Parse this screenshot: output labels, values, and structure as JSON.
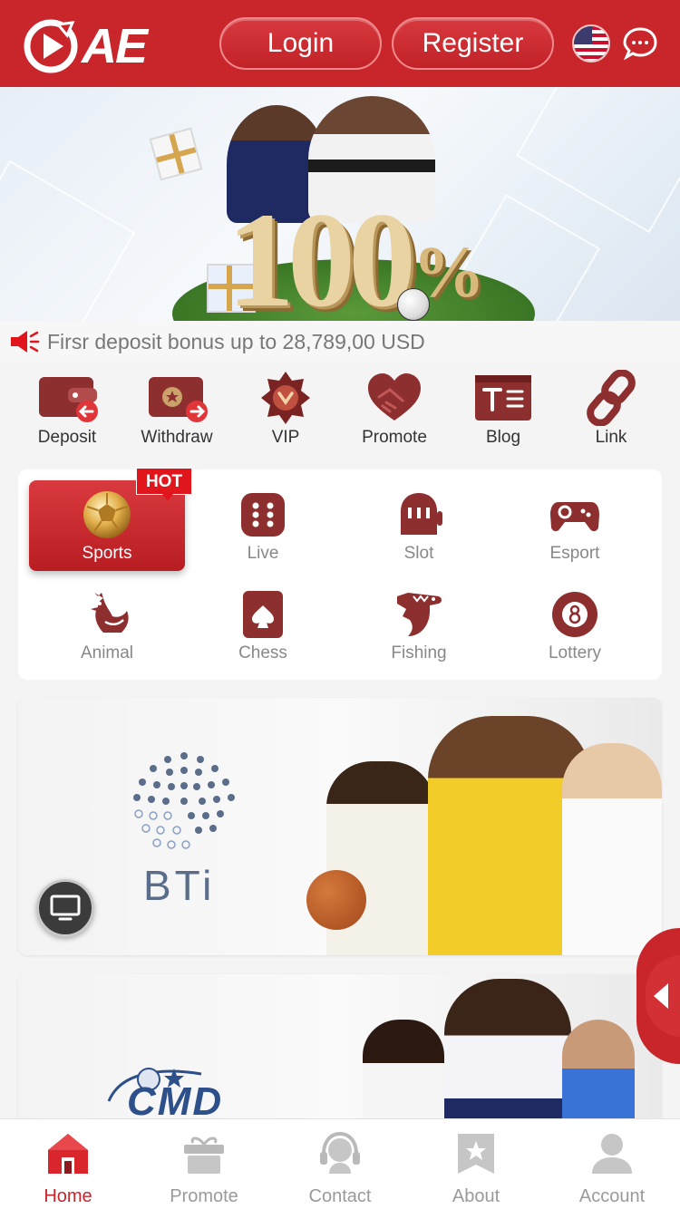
{
  "header": {
    "logo_text": "AE",
    "login_label": "Login",
    "register_label": "Register",
    "language_icon": "us-flag-icon",
    "chat_icon": "chat-bubble-icon"
  },
  "banner": {
    "headline": "100",
    "percent": "%"
  },
  "notice": {
    "text": "Firsr deposit bonus up to 28,789,00 USD"
  },
  "quick_actions": [
    {
      "label": "Deposit",
      "icon": "wallet-in-icon"
    },
    {
      "label": "Withdraw",
      "icon": "wallet-out-icon"
    },
    {
      "label": "VIP",
      "icon": "vip-badge-icon"
    },
    {
      "label": "Promote",
      "icon": "handshake-icon"
    },
    {
      "label": "Blog",
      "icon": "blog-icon"
    },
    {
      "label": "Link",
      "icon": "link-icon"
    }
  ],
  "categories": {
    "hot_badge": "HOT",
    "items": [
      {
        "label": "Sports",
        "icon": "soccer-ball-icon",
        "active": true
      },
      {
        "label": "Live",
        "icon": "dice-icon"
      },
      {
        "label": "Slot",
        "icon": "slot-machine-icon"
      },
      {
        "label": "Esport",
        "icon": "gamepad-icon"
      },
      {
        "label": "Animal",
        "icon": "rooster-icon"
      },
      {
        "label": "Chess",
        "icon": "spade-card-icon"
      },
      {
        "label": "Fishing",
        "icon": "shark-icon"
      },
      {
        "label": "Lottery",
        "icon": "lottery-ball-icon"
      }
    ]
  },
  "games": [
    {
      "brand": "BTi"
    },
    {
      "brand": "CMD"
    }
  ],
  "bottom_nav": [
    {
      "label": "Home",
      "icon": "home-icon",
      "active": true
    },
    {
      "label": "Promote",
      "icon": "gift-icon"
    },
    {
      "label": "Contact",
      "icon": "headset-icon"
    },
    {
      "label": "About",
      "icon": "star-badge-icon"
    },
    {
      "label": "Account",
      "icon": "user-icon"
    }
  ],
  "colors": {
    "brand_red": "#c9262b",
    "icon_maroon": "#8d2f2f",
    "nav_inactive": "#9a9a9a"
  }
}
